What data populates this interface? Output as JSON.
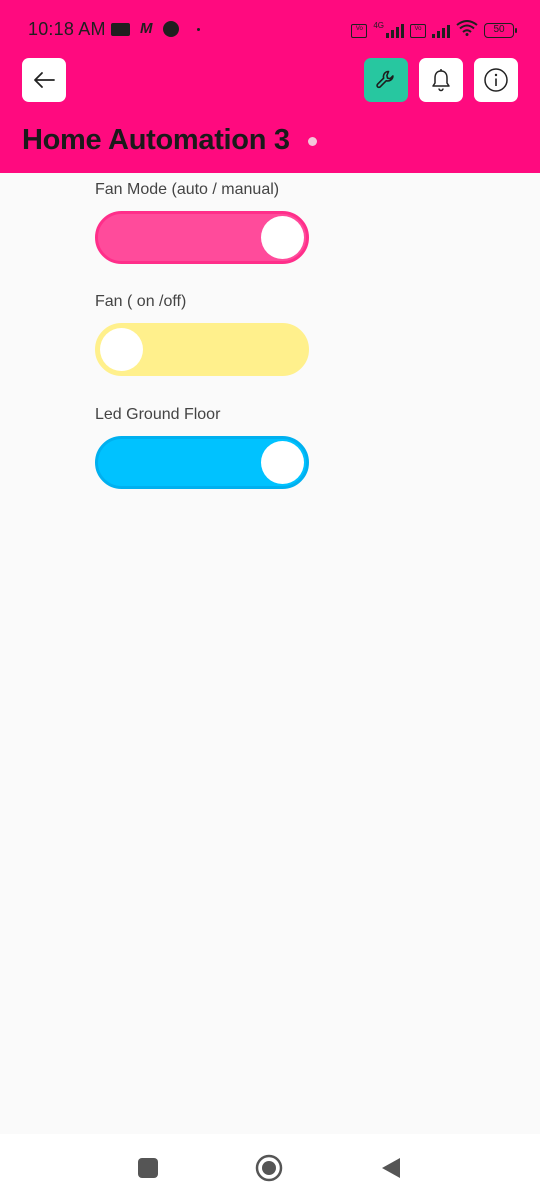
{
  "status_bar": {
    "time": "10:18 AM",
    "network_type": "4G",
    "volte_label": "Vo LTE",
    "battery": "50"
  },
  "header": {
    "title": "Home Automation 3",
    "background": "#ff0a7f",
    "buttons": {
      "back": "arrow-left-icon",
      "settings": "wrench-icon",
      "notifications": "bell-icon",
      "info": "info-icon"
    }
  },
  "switches": [
    {
      "label": "Fan Mode (auto / manual)",
      "state": "on",
      "track_color": "#ff4b9b",
      "border_color": "#ff2e8a"
    },
    {
      "label": "Fan ( on /off)",
      "state": "off",
      "track_color": "#fff08c",
      "border_color": "#fff08c"
    },
    {
      "label": "Led Ground Floor",
      "state": "on",
      "track_color": "#00c2ff",
      "border_color": "#00b0ef"
    }
  ],
  "nav": {
    "recent": "square-icon",
    "home": "circle-icon",
    "back": "triangle-back-icon"
  }
}
